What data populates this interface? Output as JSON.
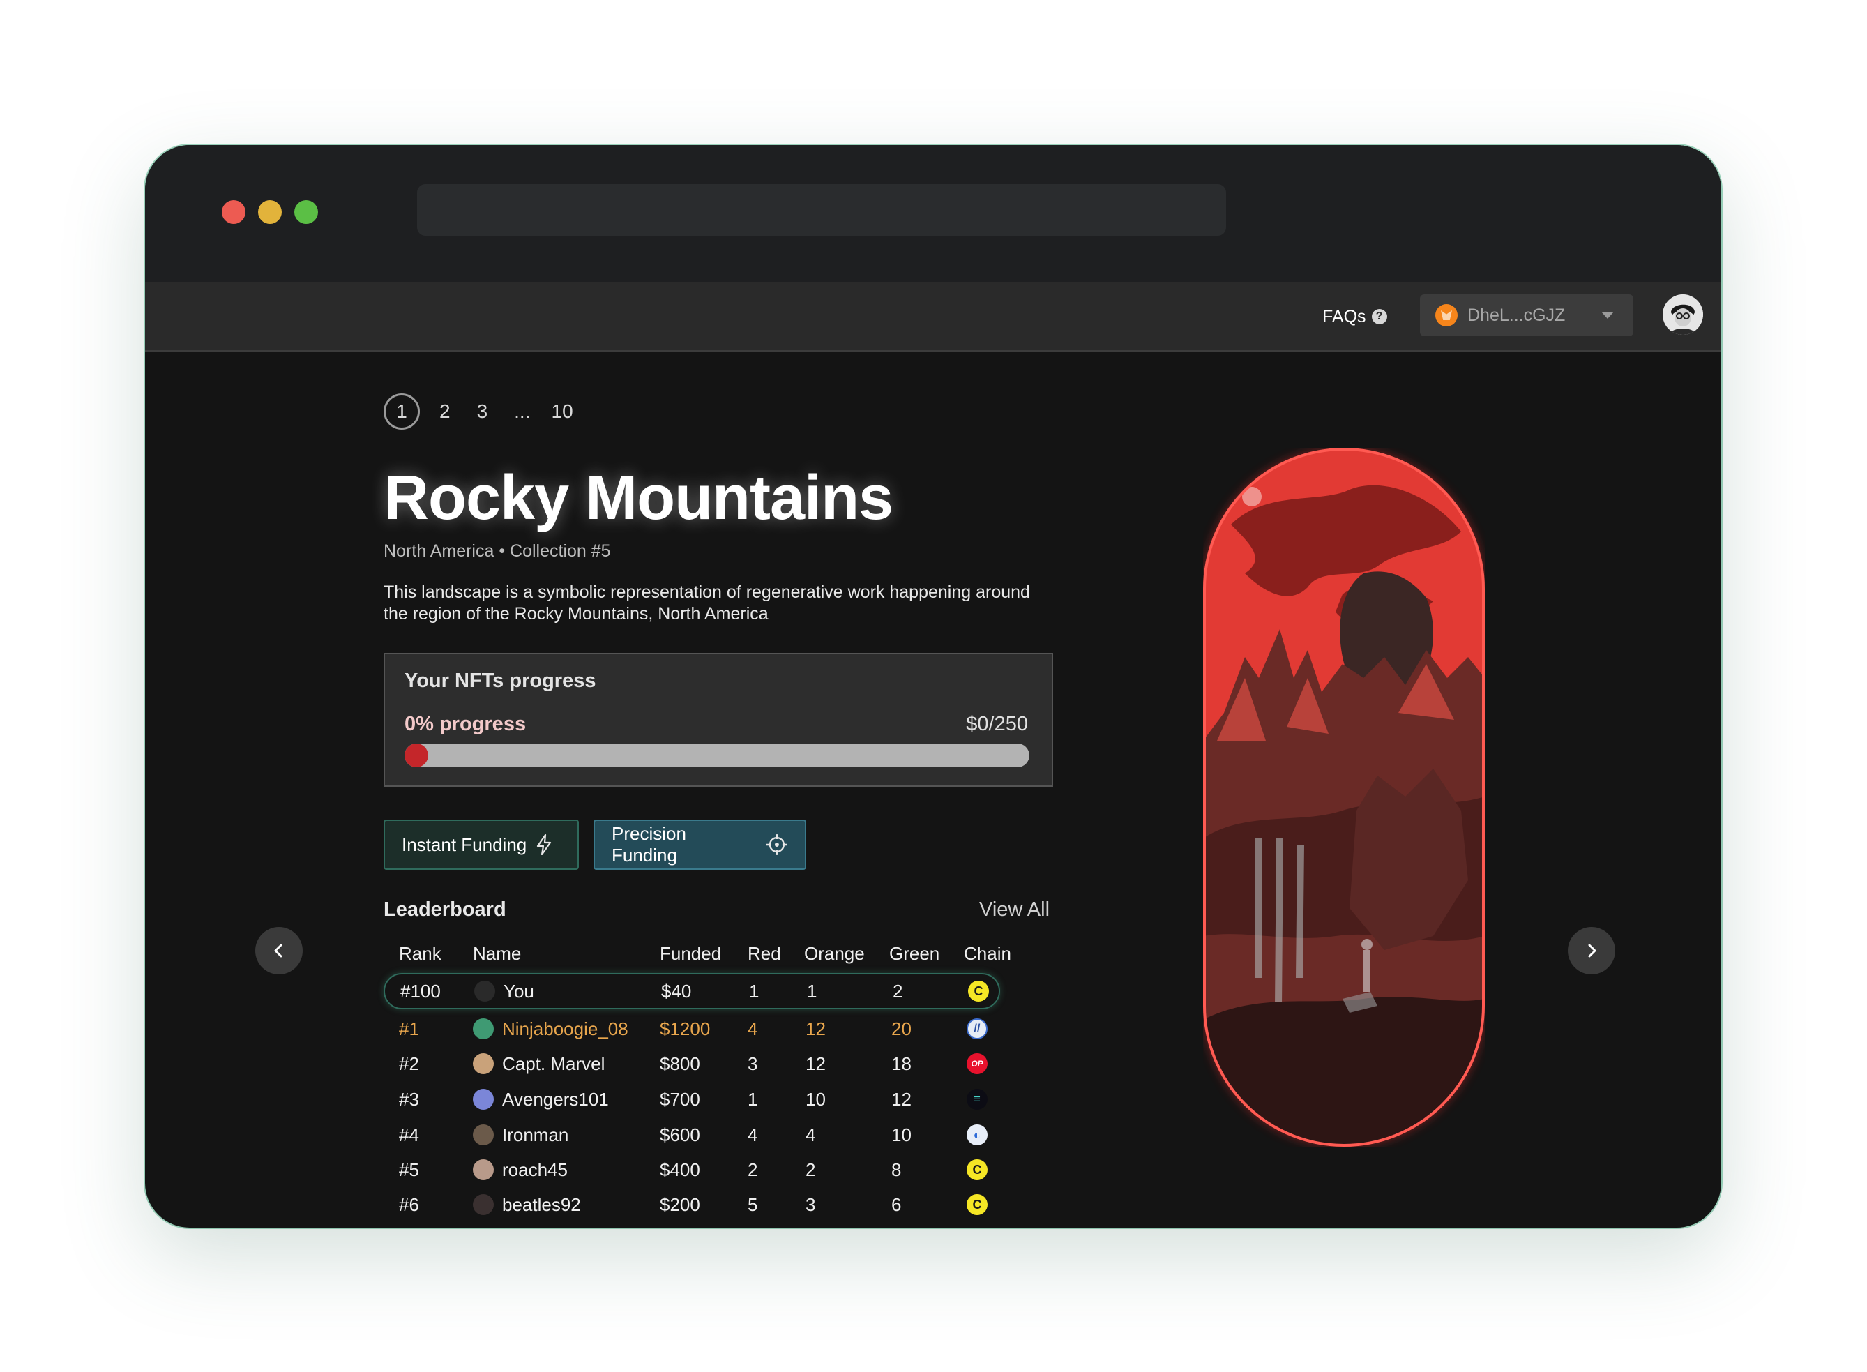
{
  "header": {
    "faqs_label": "FAQs",
    "wallet_label": "DheL...cGJZ"
  },
  "pagination": [
    "1",
    "2",
    "3",
    "...",
    "10"
  ],
  "collection": {
    "title": "Rocky Mountains",
    "subtitle": "North America • Collection #5",
    "description": "This landscape is a symbolic representation of regenerative work happening around the region of the Rocky Mountains, North America"
  },
  "progress": {
    "title": "Your NFTs progress",
    "percent_label": "0% progress",
    "amount_label": "$0/250",
    "fraction": 0
  },
  "buttons": {
    "instant": "Instant Funding",
    "precision": "Precision Funding"
  },
  "leaderboard": {
    "title": "Leaderboard",
    "view_all": "View All",
    "columns": [
      "Rank",
      "Name",
      "Funded",
      "Red",
      "Orange",
      "Green",
      "Chain"
    ],
    "rows": [
      {
        "rank": "#100",
        "name": "You",
        "funded": "$40",
        "red": "1",
        "orange": "1",
        "green": "2",
        "chain": "celo-icon",
        "avatar": "#2a2a2a"
      },
      {
        "rank": "#1",
        "name": "Ninjaboogie_08",
        "funded": "$1200",
        "red": "4",
        "orange": "12",
        "green": "20",
        "chain": "arbitrum-icon",
        "avatar": "#3f9a73"
      },
      {
        "rank": "#2",
        "name": "Capt. Marvel",
        "funded": "$800",
        "red": "3",
        "orange": "12",
        "green": "18",
        "chain": "optimism-icon",
        "avatar": "#c9a27a"
      },
      {
        "rank": "#3",
        "name": "Avengers101",
        "funded": "$700",
        "red": "1",
        "orange": "10",
        "green": "12",
        "chain": "solana-icon",
        "avatar": "#7b86d8"
      },
      {
        "rank": "#4",
        "name": "Ironman",
        "funded": "$600",
        "red": "4",
        "orange": "4",
        "green": "10",
        "chain": "ethereum-icon",
        "avatar": "#6b5a4a"
      },
      {
        "rank": "#5",
        "name": "roach45",
        "funded": "$400",
        "red": "2",
        "orange": "2",
        "green": "8",
        "chain": "celo-icon",
        "avatar": "#b89a8a"
      },
      {
        "rank": "#6",
        "name": "beatles92",
        "funded": "$200",
        "red": "5",
        "orange": "3",
        "green": "6",
        "chain": "celo-icon",
        "avatar": "#3a3030"
      }
    ]
  },
  "colors": {
    "accent_red": "#c4262a",
    "instant_button": "#1c2e29",
    "precision_button": "#234b58",
    "rank_one_gold": "#e8a64d"
  }
}
